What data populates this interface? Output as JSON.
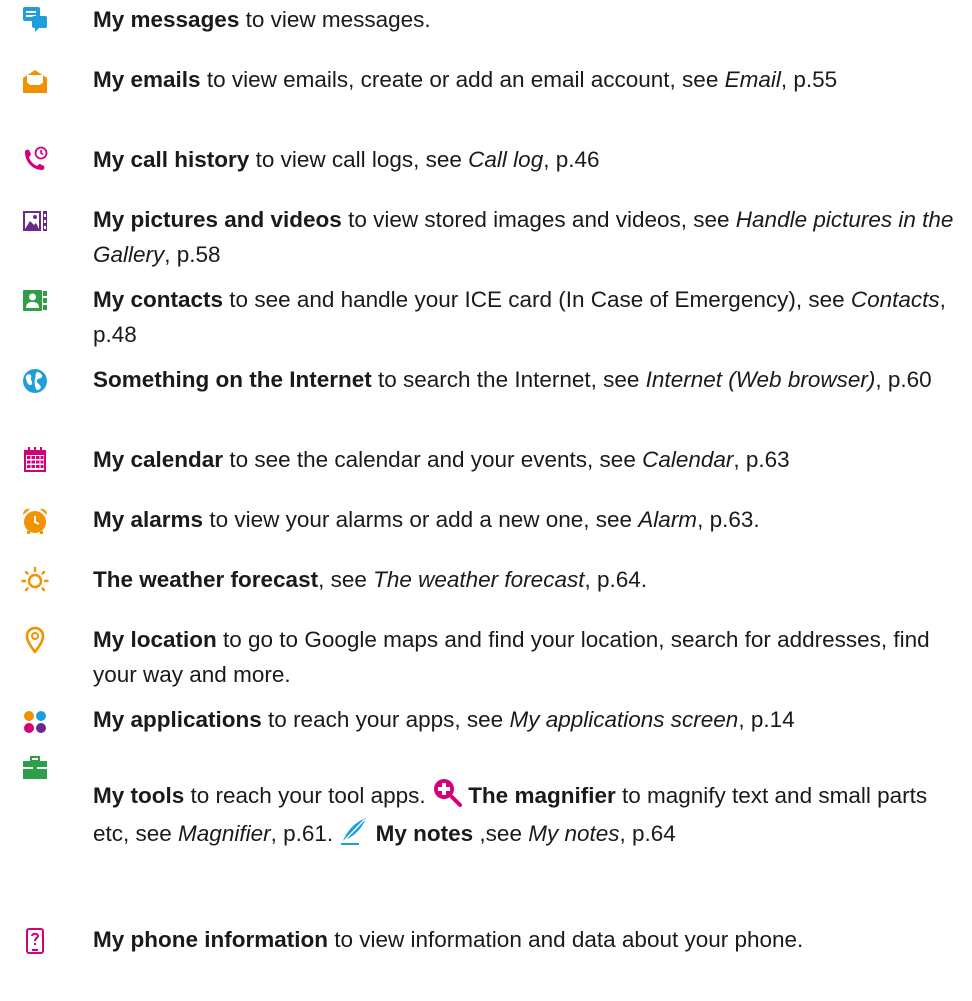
{
  "colors": {
    "accent_blue": "#1e9fdc",
    "accent_orange": "#f39200",
    "accent_pink": "#d3007b",
    "accent_green": "#2e9e49",
    "accent_purple": "#6a2a8c"
  },
  "entries": [
    {
      "icon": "messages-icon",
      "bold": "My messages",
      "text": " to view messages."
    },
    {
      "icon": "email-icon",
      "bold": "My emails",
      "pre": " to view emails, create or add an email account, see ",
      "ref": "Email",
      "post": ", p.55"
    },
    {
      "icon": "call-history-icon",
      "bold": "My call history",
      "pre": " to view call logs, see ",
      "ref": "Call log",
      "post": ", p.46"
    },
    {
      "icon": "gallery-icon",
      "bold": "My pictures and videos",
      "pre": " to view stored images and videos, see ",
      "ref": "Handle pictures in the Gallery",
      "post": ", p.58"
    },
    {
      "icon": "contacts-icon",
      "bold": "My contacts",
      "pre": " to see and handle your ICE card (In Case of Emergency), see ",
      "ref": "Contacts",
      "post": ", p.48"
    },
    {
      "icon": "globe-icon",
      "bold": "Something on the Internet",
      "pre": " to search the Internet, see ",
      "ref": "Internet (Web browser)",
      "post": ", p.60"
    },
    {
      "icon": "calendar-icon",
      "bold": "My calendar",
      "pre": " to see the calendar and your events, see ",
      "ref": "Calendar",
      "post": ", p.63"
    },
    {
      "icon": "alarm-icon",
      "bold": "My alarms",
      "pre": " to view your alarms or add a new one, see ",
      "ref": "Alarm",
      "post": ", p.63."
    },
    {
      "icon": "sun-icon",
      "bold": "The weather forecast",
      "pre": ", see ",
      "ref": "The weather forecast",
      "post": ", p.64."
    },
    {
      "icon": "location-pin-icon",
      "bold": "My location",
      "text": " to go to Google maps and find your location, search for addresses, find your way and more."
    },
    {
      "icon": "applications-icon",
      "bold": "My applications",
      "pre": " to reach your apps, see ",
      "ref": "My applications screen",
      "post": ", p.14"
    },
    {
      "icon": "toolbox-icon",
      "bold": "My tools",
      "pre": " to reach your tool apps. ",
      "magnifier_bold": "The magnifier",
      "magnifier_pre": " to magnify text and small parts etc, see ",
      "magnifier_ref": "Magnifier",
      "magnifier_post": ", p.61. ",
      "notes_bold": "My notes",
      "notes_pre": " ,see ",
      "notes_ref": "My notes",
      "notes_post": ", p.64"
    },
    {
      "icon": "phone-info-icon",
      "bold": "My phone information",
      "text": " to view information and data about your phone."
    }
  ]
}
